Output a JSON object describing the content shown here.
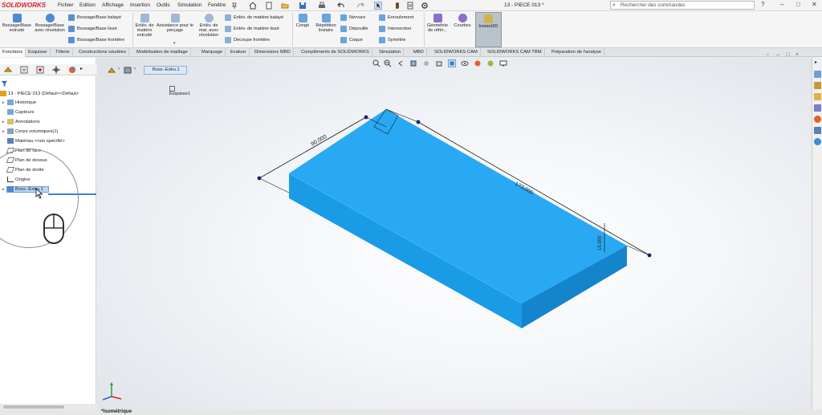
{
  "app": {
    "brand": "SOLIDWORKS",
    "document_title": "13 - PIECE 013 *"
  },
  "menus": [
    "Fichier",
    "Edition",
    "Affichage",
    "Insertion",
    "Outils",
    "Simulation",
    "Fenêtre"
  ],
  "search": {
    "placeholder": "Rechercher des commandes"
  },
  "ribbon": {
    "bossage_extrude": "Bossage/Base extrudé",
    "bossage_revolution": "Bossage/Base avec révolution",
    "bossage_balaye": "Bossage/Base balayé",
    "bossage_lisse": "Bossage/Base lissé",
    "bossage_frontiere": "Bossage/Base frontière",
    "enlev_extrude": "Enlév. de matière extrudé",
    "assistance_percage": "Assistance pour le perçage",
    "enlev_revolution": "Enlév. de mat. avec révolution",
    "enlev_balaye": "Enlév. de matière balayé",
    "enlev_lisse": "Enlév. de matière lissé",
    "decoupe_frontiere": "Découpe frontière",
    "conge": "Congé",
    "repetition": "Répétition linéaire",
    "nervure": "Nervure",
    "depouille": "Dépouille",
    "coque": "Coque",
    "enroulement": "Enroulement",
    "intersection": "Intersection",
    "symetrie": "Symétrie",
    "geometrie": "Géométrie de référ...",
    "courbes": "Courbes",
    "instant3d": "Instant3D"
  },
  "tabs": [
    "Fonctions",
    "Esquisse",
    "Tôlerie",
    "Constructions soudées",
    "Modélisation de maillage",
    "Marquage",
    "Evaluer",
    "Dimensions MBD",
    "Compléments de SOLIDWORKS",
    "Simulation",
    "MBD",
    "SOLIDWORKS CAM",
    "SOLIDWORKS CAM TBM",
    "Préparation de l'analyse"
  ],
  "tree": {
    "root": "13 - PIECE 013  (Défaut<<Défaut>",
    "items": [
      "Historique",
      "Capteurs",
      "Annotations",
      "Corps volumiques(1)",
      "Matériau <non spécifié>",
      "Plan de face",
      "Plan de dessus",
      "Plan de droite",
      "Origine",
      "Boss.-Extru.1"
    ]
  },
  "breadcrumb": {
    "feature": "Boss.-Extru.1",
    "sketch": "Esquisse1"
  },
  "dimensions": {
    "width": "90.000",
    "length": "173.000",
    "height": "15.000"
  },
  "view": {
    "name": "*Isométrique"
  },
  "colors": {
    "part": "#2aa6ee",
    "part_top": "#29a9f3",
    "part_front": "#1790db",
    "part_side": "#1a86cc",
    "brand": "#d2222d"
  }
}
